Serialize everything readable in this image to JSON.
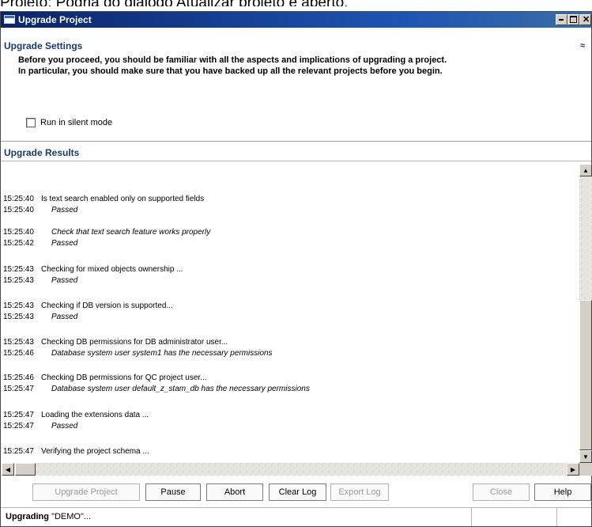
{
  "top_caption": "Projeto: Podria do diálogo Atualizar projeto é aberto.",
  "window": {
    "title": "Upgrade Project",
    "controls": {
      "minimize": "minimize",
      "maximize": "maximize",
      "close": "✕"
    }
  },
  "settings": {
    "header": "Upgrade Settings",
    "collapse_icon": "double-chevron-up",
    "collapse_glyph": "≈",
    "intro_line1": "Before you proceed, you should be familiar with all the aspects and implications of upgrading a project.",
    "intro_line2": "In particular, you should make sure that you have backed up all the relevant projects before you begin.",
    "silent_mode_label": "Run in silent mode",
    "silent_mode_checked": false
  },
  "results": {
    "header": "Upgrade Results",
    "log": [
      {
        "time": "15:25:40",
        "text": "Is text search enabled only on supported fields",
        "style": "plain"
      },
      {
        "time": "15:25:40",
        "text": "Passed",
        "style": "italic"
      },
      {
        "time": "15:25:40",
        "text": "Check that text search feature works properly",
        "style": "italic"
      },
      {
        "time": "15:25:42",
        "text": "Passed",
        "style": "italic"
      },
      {
        "time": "15:25:43",
        "text": "Checking for mixed objects ownership ...",
        "style": "plain"
      },
      {
        "time": "15:25:43",
        "text": "Passed",
        "style": "italic"
      },
      {
        "time": "15:25:43",
        "text": "Checking if DB version is supported...",
        "style": "plain"
      },
      {
        "time": "15:25:43",
        "text": "Passed",
        "style": "italic"
      },
      {
        "time": "15:25:43",
        "text": "Checking DB permissions for DB administrator user...",
        "style": "plain"
      },
      {
        "time": "15:25:46",
        "text": "Database system user system1 has the necessary permissions",
        "style": "italic"
      },
      {
        "time": "15:25:46",
        "text": "Checking DB permissions for QC project user...",
        "style": "plain"
      },
      {
        "time": "15:25:47",
        "text": "Database system user default_z_stam_db has the necessary permissions",
        "style": "italic"
      },
      {
        "time": "15:25:47",
        "text": "Loading the extensions data ...",
        "style": "plain"
      },
      {
        "time": "15:25:47",
        "text": "Passed",
        "style": "italic"
      },
      {
        "time": "15:25:47",
        "text": "Verifying the project schema ...",
        "style": "plain"
      }
    ]
  },
  "scroll_glyphs": {
    "up": "▲",
    "down": "▼",
    "left": "◀",
    "right": "▶"
  },
  "buttons": {
    "upgrade_project": "Upgrade Project",
    "pause": "Pause",
    "abort": "Abort",
    "clear_log": "Clear Log",
    "export_log": "Export Log",
    "close": "Close",
    "help": "Help"
  },
  "status": {
    "prefix": "Upgrading",
    "project": "\"DEMO\"..."
  }
}
